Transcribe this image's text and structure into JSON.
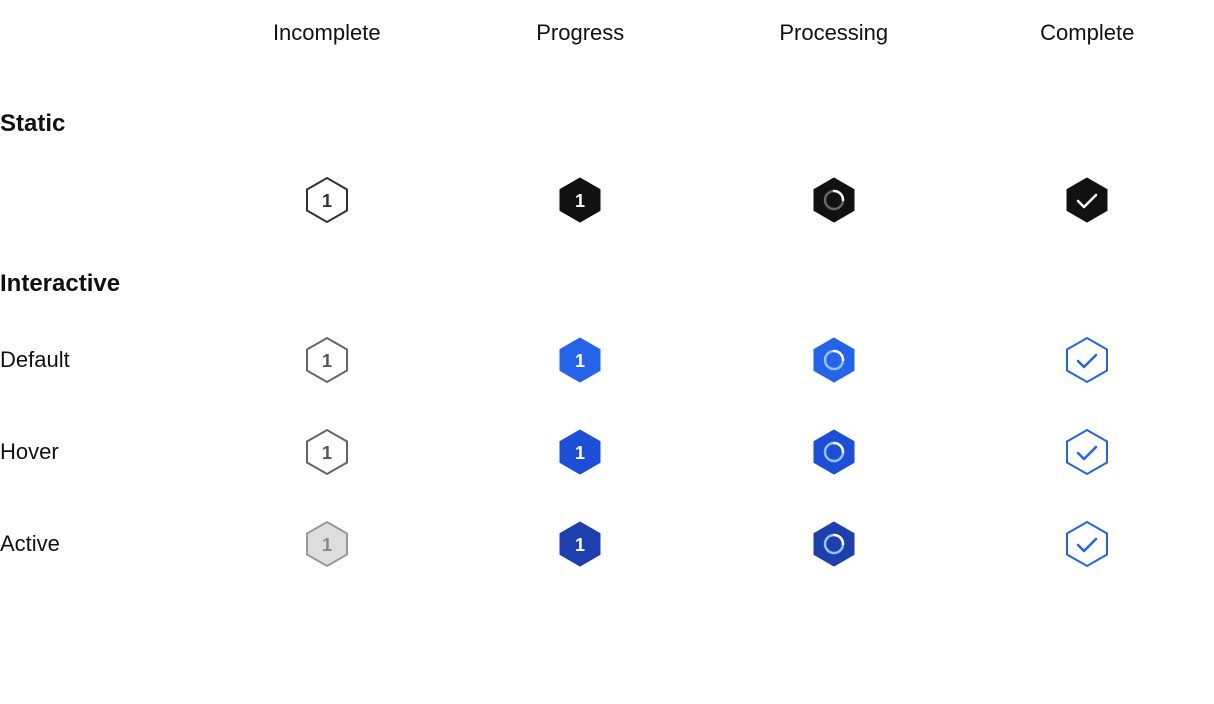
{
  "columns": {
    "empty": "",
    "incomplete": "Incomplete",
    "progress": "Progress",
    "processing": "Processing",
    "complete": "Complete"
  },
  "sections": [
    {
      "label": "Static",
      "rows": [
        {
          "name": "",
          "states": [
            "static-incomplete",
            "static-progress",
            "static-processing",
            "static-complete"
          ]
        }
      ]
    },
    {
      "label": "Interactive",
      "rows": [
        {
          "name": "Default",
          "states": [
            "interactive-default-incomplete",
            "interactive-default-progress",
            "interactive-default-processing",
            "interactive-default-complete"
          ]
        },
        {
          "name": "Hover",
          "states": [
            "interactive-hover-incomplete",
            "interactive-hover-progress",
            "interactive-hover-processing",
            "interactive-hover-complete"
          ]
        },
        {
          "name": "Active",
          "states": [
            "interactive-active-incomplete",
            "interactive-active-progress",
            "interactive-active-processing",
            "interactive-active-complete"
          ]
        }
      ]
    }
  ]
}
